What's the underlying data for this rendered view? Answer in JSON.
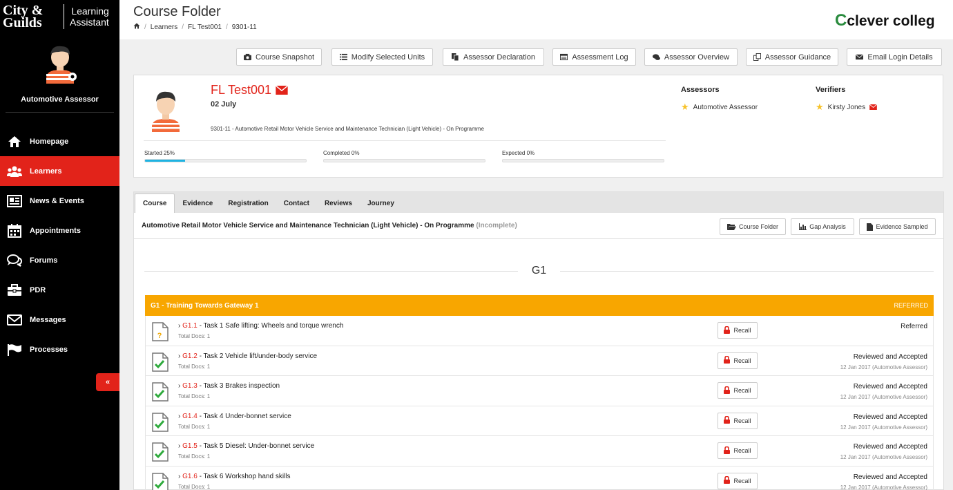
{
  "brand": {
    "logo_line1": "City &",
    "logo_line2": "Guilds",
    "sub_line1": "Learning",
    "sub_line2": "Assistant"
  },
  "user": {
    "role": "Automotive Assessor"
  },
  "nav": [
    {
      "label": "Homepage",
      "icon": "home-icon"
    },
    {
      "label": "Learners",
      "icon": "users-icon",
      "active": true
    },
    {
      "label": "News & Events",
      "icon": "newspaper-icon"
    },
    {
      "label": "Appointments",
      "icon": "calendar-icon"
    },
    {
      "label": "Forums",
      "icon": "comments-icon"
    },
    {
      "label": "PDR",
      "icon": "briefcase-icon"
    },
    {
      "label": "Messages",
      "icon": "envelope-icon"
    },
    {
      "label": "Processes",
      "icon": "flag-icon"
    }
  ],
  "collapse_label": "«",
  "header": {
    "title": "Course Folder",
    "breadcrumb": [
      "Learners",
      "FL Test001",
      "9301-11"
    ],
    "college_prefix": "C",
    "college_name": "clever colleg"
  },
  "toolbar": {
    "course_snapshot": "Course Snapshot",
    "modify_units": "Modify Selected Units",
    "assessor_declaration": "Assessor Declaration",
    "assessment_log": "Assessment Log",
    "assessor_overview": "Assessor Overview",
    "assessor_guidance": "Assessor Guidance",
    "email_login": "Email Login Details"
  },
  "learner": {
    "name": "FL Test001",
    "date": "02 July",
    "course": "9301-11 - Automotive Retail Motor Vehicle Service and Maintenance Technician (Light Vehicle) - On Programme",
    "progress": [
      {
        "label": "Started 25%",
        "value": 25
      },
      {
        "label": "Completed 0%",
        "value": 0
      },
      {
        "label": "Expected 0%",
        "value": 0
      }
    ],
    "assessors_heading": "Assessors",
    "assessor": "Automotive Assessor",
    "verifiers_heading": "Verifiers",
    "verifier": "Kirsty Jones"
  },
  "tabs": [
    "Course",
    "Evidence",
    "Registration",
    "Contact",
    "Reviews",
    "Journey"
  ],
  "course_bar": {
    "title": "Automotive Retail Motor Vehicle Service and Maintenance Technician (Light Vehicle) - On Programme",
    "status": "(Incomplete)",
    "course_folder": "Course Folder",
    "gap_analysis": "Gap Analysis",
    "evidence_sampled": "Evidence Sampled"
  },
  "group": {
    "title": "G1",
    "header": "G1 - Training Towards Gateway 1",
    "state": "REFERRED",
    "header_color": "#f8a600"
  },
  "units": [
    {
      "prefix": "› ",
      "code": "G1.1",
      "name": " - Task 1 Safe lifting: Wheels and torque wrench",
      "docs": "Total Docs: 1",
      "recall": "Recall",
      "status": "Referred",
      "meta": "",
      "icon": "document-question-icon"
    },
    {
      "prefix": "› ",
      "code": "G1.2",
      "name": " - Task 2 Vehicle lift/under-body service",
      "docs": "Total Docs: 1",
      "recall": "Recall",
      "status": "Reviewed and Accepted",
      "meta": "12 Jan 2017 (Automotive Assessor)",
      "icon": "document-check-icon"
    },
    {
      "prefix": "› ",
      "code": "G1.3",
      "name": " - Task 3 Brakes inspection",
      "docs": "Total Docs: 1",
      "recall": "Recall",
      "status": "Reviewed and Accepted",
      "meta": "12 Jan 2017 (Automotive Assessor)",
      "icon": "document-check-icon"
    },
    {
      "prefix": "› ",
      "code": "G1.4",
      "name": " - Task 4 Under-bonnet service",
      "docs": "Total Docs: 1",
      "recall": "Recall",
      "status": "Reviewed and Accepted",
      "meta": "12 Jan 2017 (Automotive Assessor)",
      "icon": "document-check-icon"
    },
    {
      "prefix": "› ",
      "code": "G1.5",
      "name": " - Task 5 Diesel: Under-bonnet service",
      "docs": "Total Docs: 1",
      "recall": "Recall",
      "status": "Reviewed and Accepted",
      "meta": "12 Jan 2017 (Automotive Assessor)",
      "icon": "document-check-icon"
    },
    {
      "prefix": "› ",
      "code": "G1.6",
      "name": " - Task 6 Workshop hand skills",
      "docs": "Total Docs: 1",
      "recall": "Recall",
      "status": "Reviewed and Accepted",
      "meta": "12 Jan 2017 (Automotive Assessor)",
      "icon": "document-check-icon"
    }
  ],
  "colors": {
    "accent_red": "#e2231a",
    "progress_blue": "#1fb3e2",
    "check_green": "#2eaa3c",
    "star": "#f7c22a"
  }
}
